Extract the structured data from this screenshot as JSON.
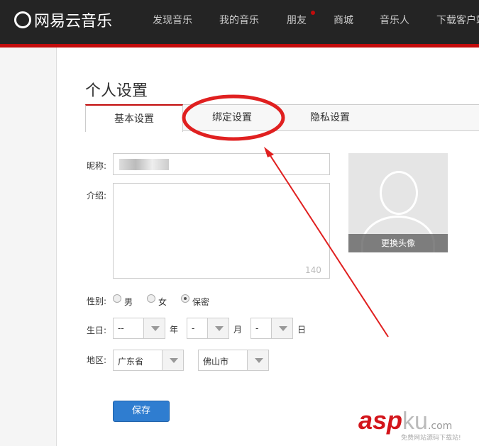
{
  "header": {
    "logo": "网易云音乐",
    "nav": [
      "发现音乐",
      "我的音乐",
      "朋友",
      "商城",
      "音乐人",
      "下载客户端"
    ]
  },
  "page": {
    "title": "个人设置",
    "tabs": [
      "基本设置",
      "绑定设置",
      "隐私设置"
    ]
  },
  "form": {
    "nickname_label": "昵称:",
    "intro_label": "介绍:",
    "intro_count": "140",
    "gender_label": "性别:",
    "genders": [
      "男",
      "女",
      "保密"
    ],
    "gender_selected": "保密",
    "birthday_label": "生日:",
    "year": "--",
    "month": "-",
    "day": "-",
    "year_unit": "年",
    "month_unit": "月",
    "day_unit": "日",
    "region_label": "地区:",
    "province": "广东省",
    "city": "佛山市",
    "save": "保存"
  },
  "avatar": {
    "change": "更换头像"
  },
  "watermark": {
    "brand": "asp",
    "brand2": "ku",
    "tld": ".com",
    "slogan": "免费网站源码下载站!"
  },
  "colors": {
    "accent": "#c20c0c",
    "button": "#2f7dd0",
    "annotation": "#e02020"
  }
}
